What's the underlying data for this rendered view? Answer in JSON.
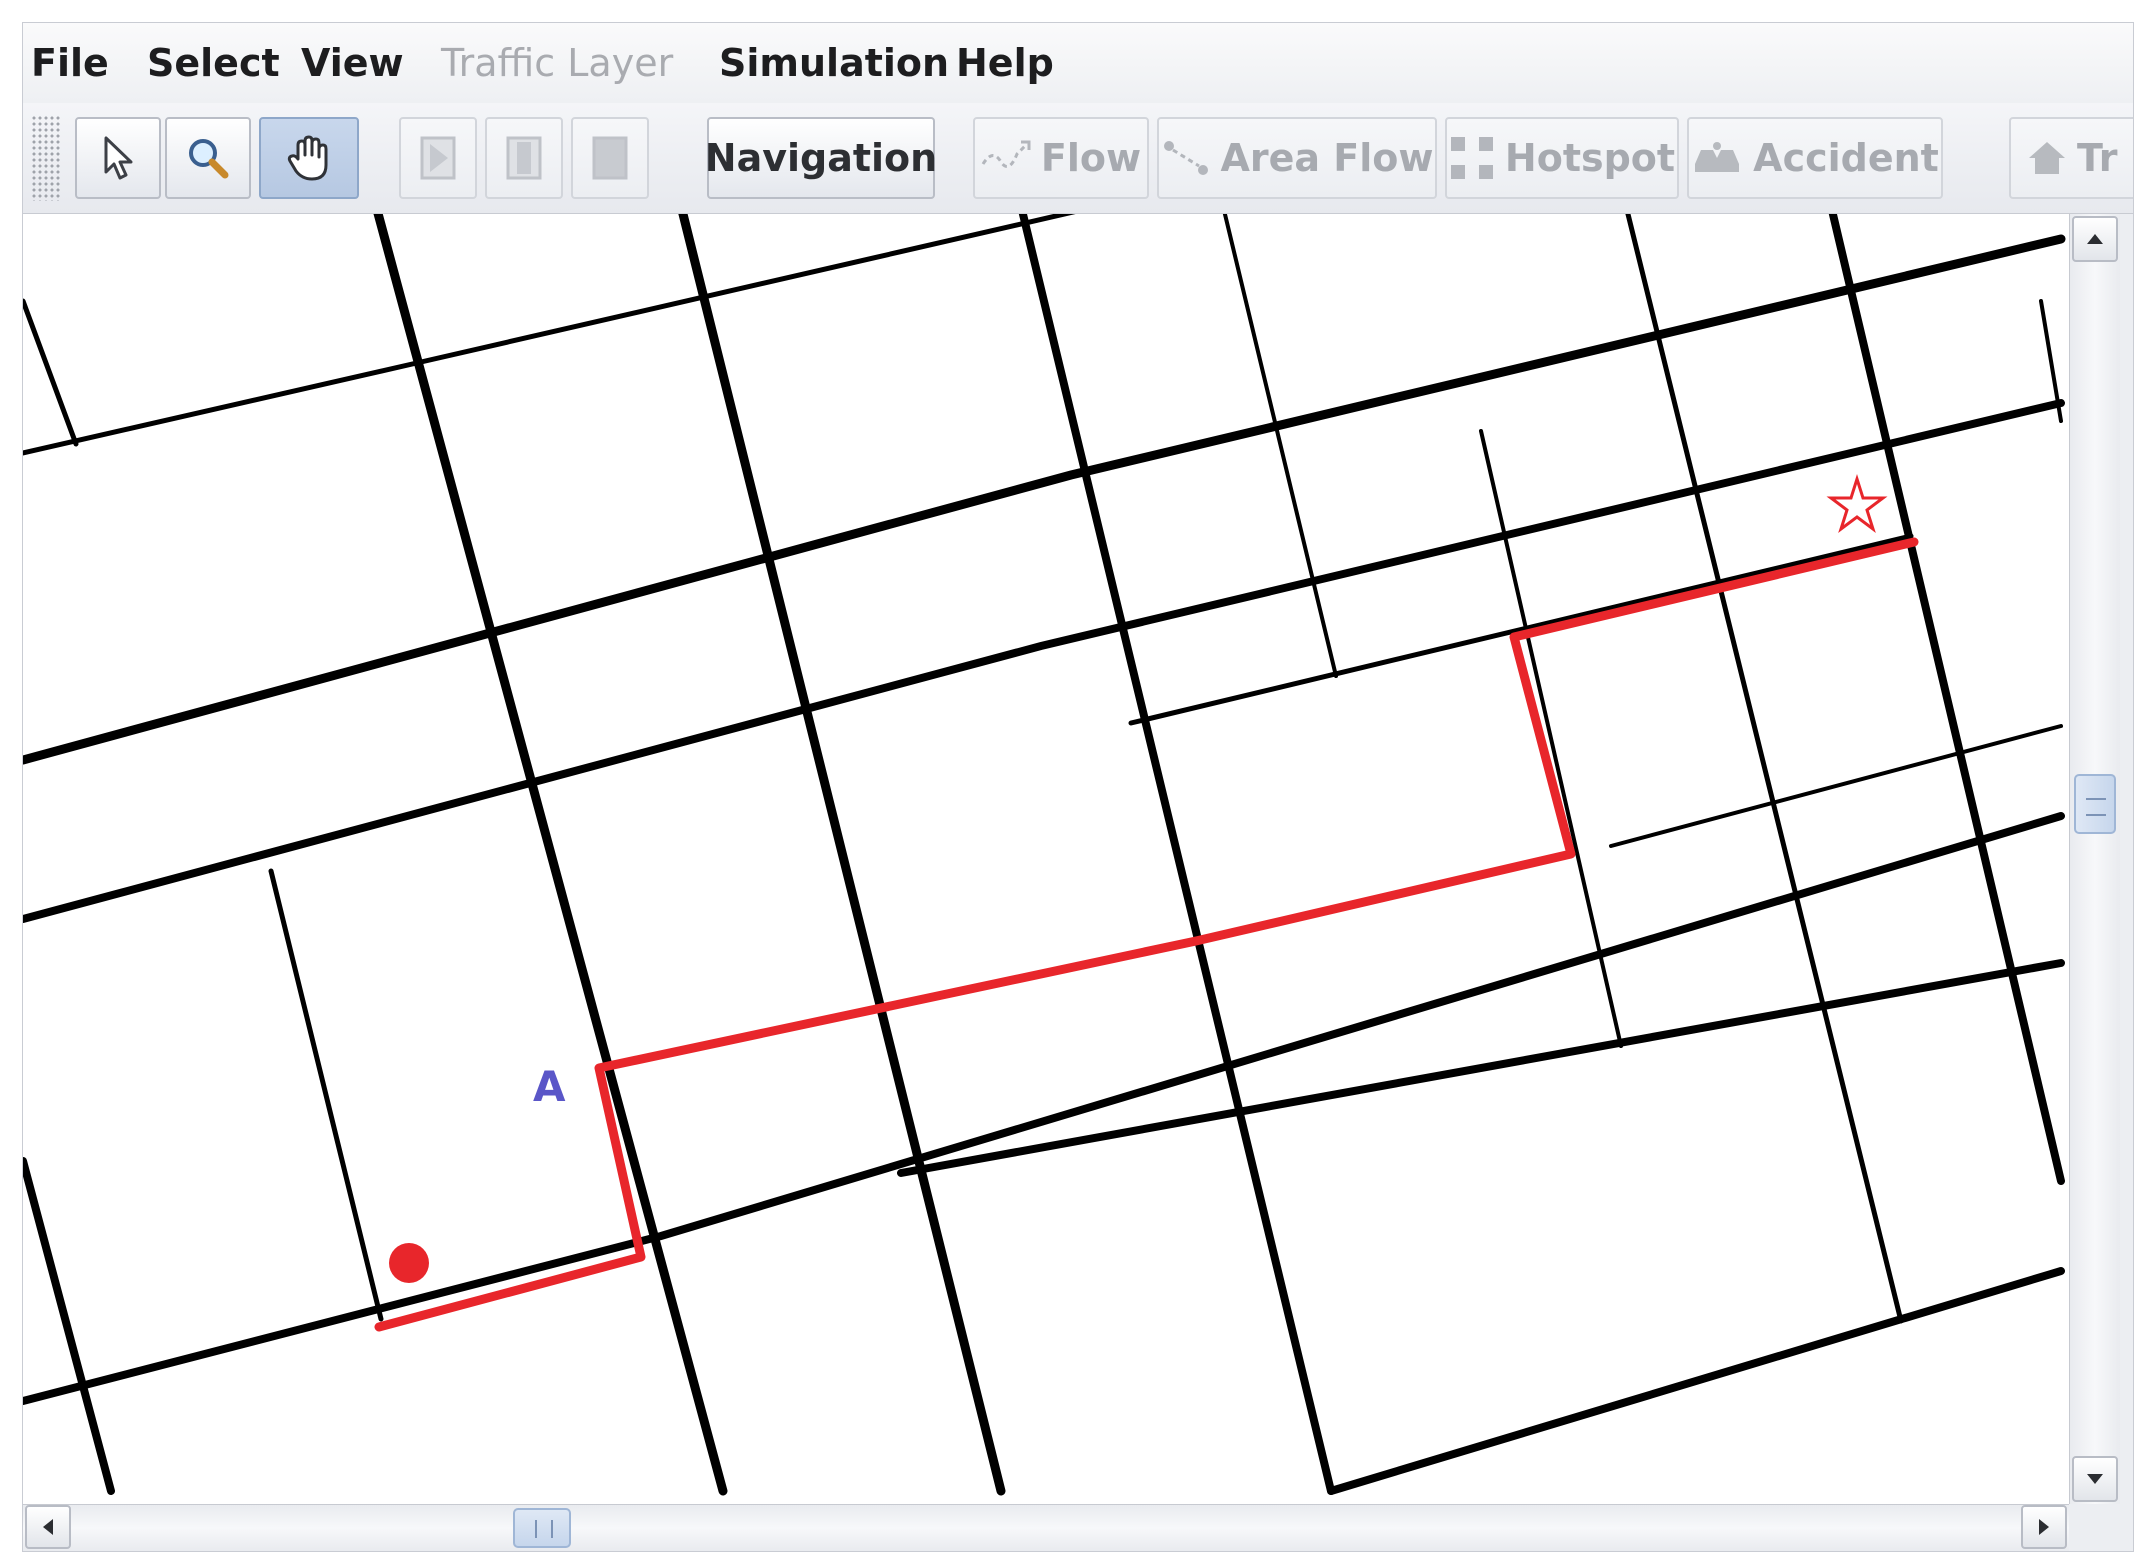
{
  "menu": {
    "file": "File",
    "select": "Select",
    "view": "View",
    "traffic_layer": "Traffic Layer",
    "simulation": "Simulation",
    "help": "Help"
  },
  "toolbar": {
    "tools": [
      {
        "icon": "arrow-pointer-icon",
        "pressed": false
      },
      {
        "icon": "magnifier-icon",
        "pressed": false
      },
      {
        "icon": "hand-pan-icon",
        "pressed": true
      }
    ],
    "playback": [
      "play-icon",
      "pause-icon",
      "stop-icon"
    ],
    "navigation_label": "Navigation",
    "flow_label": "Flow",
    "area_flow_label": "Area Flow",
    "hotspot_label": "Hotspot",
    "accident_label": "Accident",
    "truncated_label": "Tr"
  },
  "map": {
    "marker_label": "A",
    "route_color": "#e8262b",
    "road_color": "#000000",
    "label_color": "#5a56c8",
    "start_marker": "red-dot",
    "destination_marker": "star-outline"
  },
  "colors": {
    "pressed_button": "#b6c8e2",
    "disabled_text": "#a9abb0"
  }
}
